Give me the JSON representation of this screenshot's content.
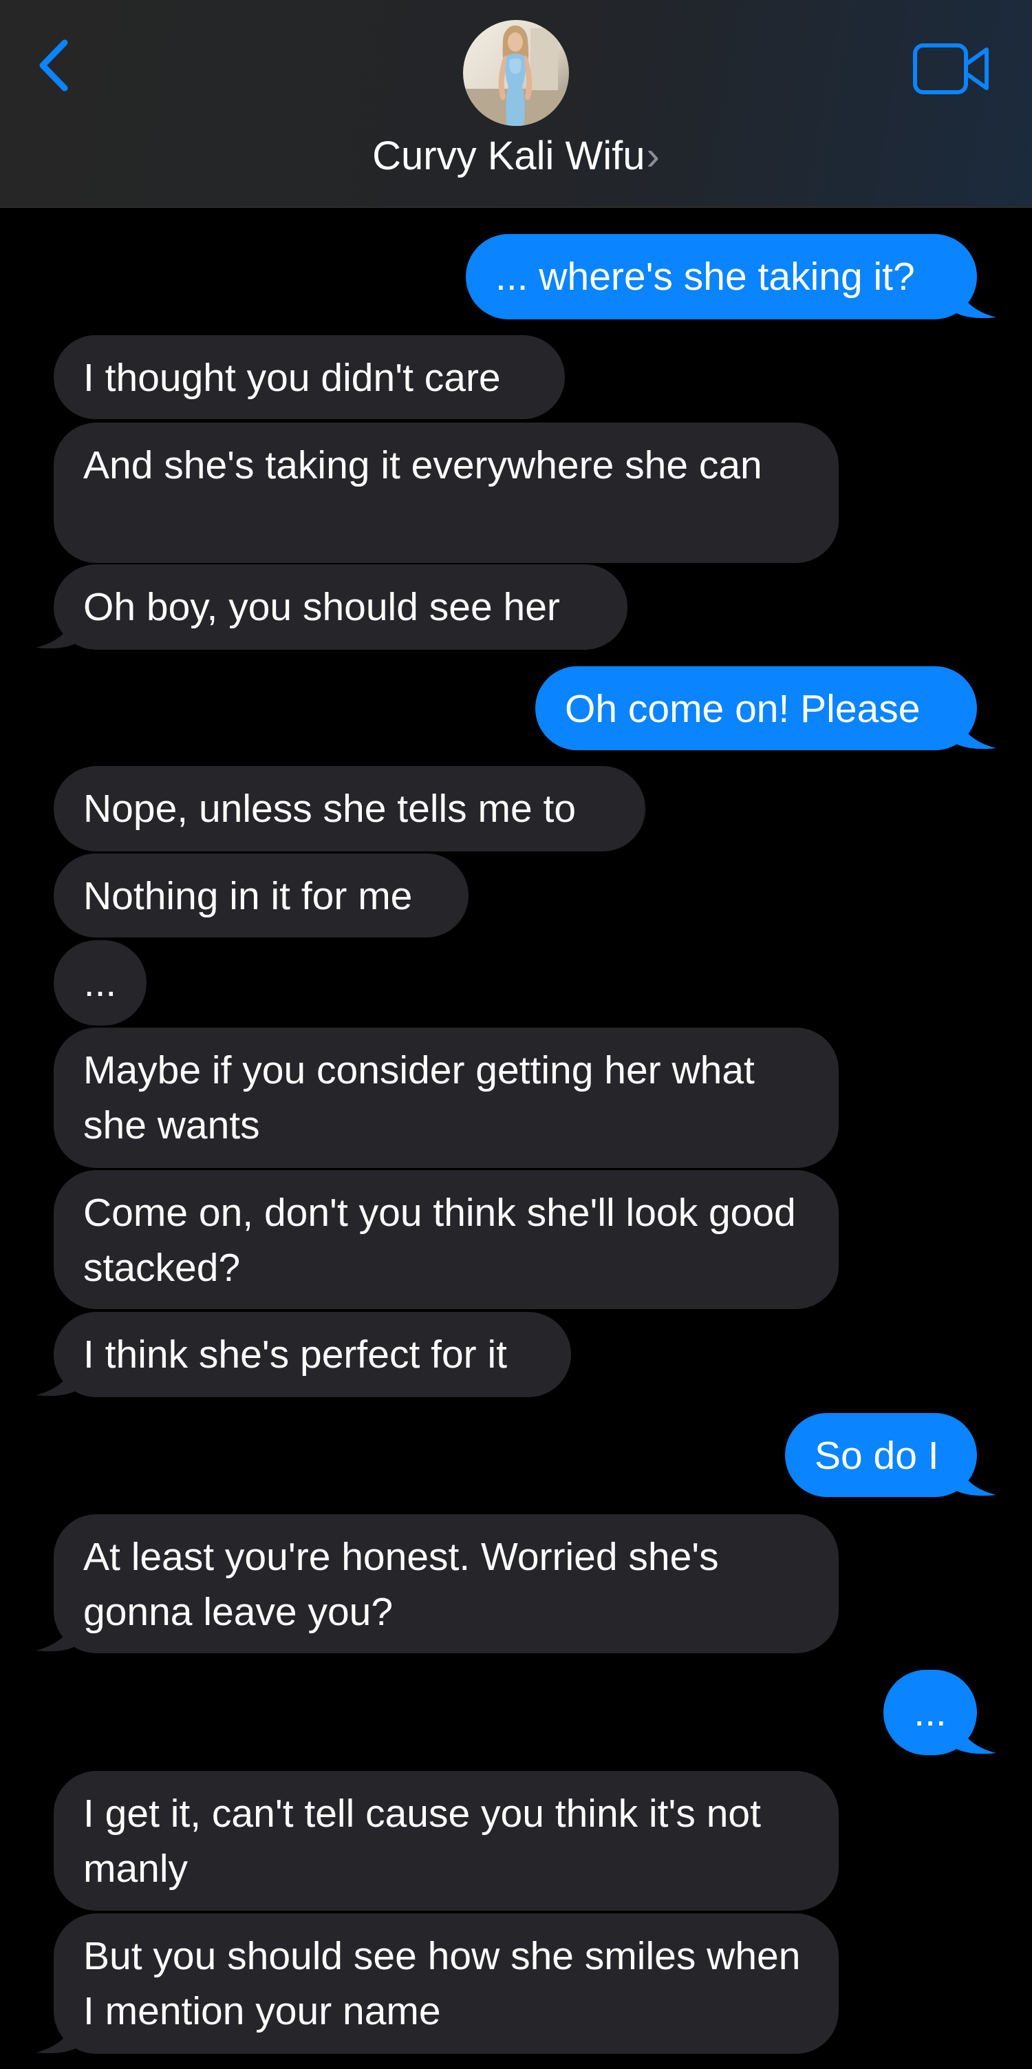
{
  "header": {
    "contact_name": "Curvy Kali Wifu",
    "chevron": "›",
    "back_icon": "chevron-left-icon",
    "video_icon": "video-camera-icon",
    "accent_color": "#0a84ff"
  },
  "messages": [
    {
      "sender": "me",
      "text": "... where's she taking it?"
    },
    {
      "sender": "contact",
      "text": "I thought you didn't care"
    },
    {
      "sender": "contact",
      "text": "And she's taking it everywhere she can"
    },
    {
      "sender": "contact",
      "text": "Oh boy, you should see her"
    },
    {
      "sender": "me",
      "text": "Oh come on! Please"
    },
    {
      "sender": "contact",
      "text": "Nope, unless she tells me to"
    },
    {
      "sender": "contact",
      "text": "Nothing in it for me"
    },
    {
      "sender": "contact",
      "text": "..."
    },
    {
      "sender": "contact",
      "text": "Maybe if you consider getting her what she wants"
    },
    {
      "sender": "contact",
      "text": "Come on, don't you think she'll look good stacked?"
    },
    {
      "sender": "contact",
      "text": "I think she's perfect for it"
    },
    {
      "sender": "me",
      "text": "So do I"
    },
    {
      "sender": "contact",
      "text": "At least you're honest. Worried she's gonna leave you?"
    },
    {
      "sender": "me",
      "text": "..."
    },
    {
      "sender": "contact",
      "text": "I get it, can't tell cause you think it's not manly"
    },
    {
      "sender": "contact",
      "text": "But you should see how she smiles when I mention your name"
    }
  ],
  "colors": {
    "incoming_bubble": "#26252a",
    "outgoing_bubble": "#0a84ff",
    "background": "#000000"
  }
}
